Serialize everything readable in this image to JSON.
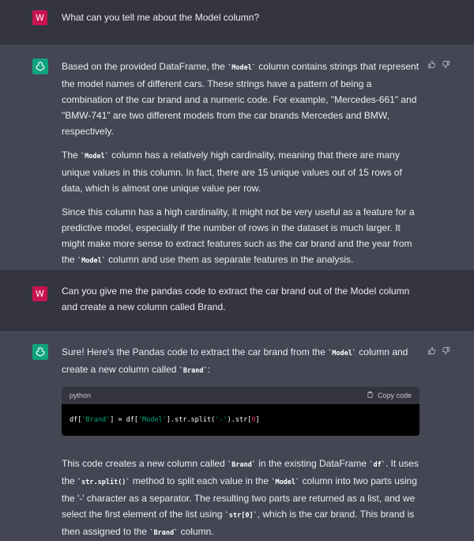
{
  "turns": [
    {
      "type": "user",
      "avatar": "W",
      "text": "What can you tell me about the Model column?"
    },
    {
      "type": "bot",
      "paragraphs": [
        [
          "Based on the provided DataFrame, the ",
          "`Model`",
          " column contains strings that represent the model names of different cars. These strings have a pattern of being a combination of the car brand and a numeric code. For example, \"Mercedes-661\" and \"BMW-741\" are two different models from the car brands Mercedes and BMW, respectively."
        ],
        [
          "The ",
          "`Model`",
          " column has a relatively high cardinality, meaning that there are many unique values in this column. In fact, there are 15 unique values out of 15 rows of data, which is almost one unique value per row."
        ],
        [
          "Since this column has a high cardinality, it might not be very useful as a feature for a predictive model, especially if the number of rows in the dataset is much larger. It might make more sense to extract features such as the car brand and the year from the ",
          "`Model`",
          " column and use them as separate features in the analysis."
        ]
      ]
    },
    {
      "type": "user",
      "avatar": "W",
      "text": "Can you give me the pandas code to extract the car brand out of the Model column and create a new column called Brand."
    },
    {
      "type": "bot",
      "intro": [
        "Sure! Here's the Pandas code to extract the car brand from the ",
        "`Model`",
        " column and create a new column called ",
        "`Brand`",
        ":"
      ],
      "code": {
        "language": "python",
        "copy_label": "Copy code",
        "line": [
          "df[",
          "'Brand'",
          "] = df[",
          "'Model'",
          "].str.split(",
          "'-'",
          ").str[",
          "0",
          "]"
        ]
      },
      "outro": [
        "This code creates a new column called ",
        "`Brand`",
        " in the existing DataFrame ",
        "`df`",
        ". It uses the ",
        "`str.split()`",
        " method to split each value in the ",
        "`Model`",
        " column into two parts using the '-' character as a separator. The resulting two parts are returned as a list, and we select the first element of the list using ",
        "`str[0]`",
        ", which is the car brand. This brand is then assigned to the ",
        "`Brand`",
        " column."
      ]
    }
  ],
  "colors": {
    "user_avatar": "#c7134f",
    "bot_avatar": "#10a37f",
    "user_bg": "#343541",
    "bot_bg": "#444654"
  },
  "icons": [
    "openai-logo-icon",
    "thumbs-up-icon",
    "thumbs-down-icon",
    "clipboard-icon"
  ]
}
